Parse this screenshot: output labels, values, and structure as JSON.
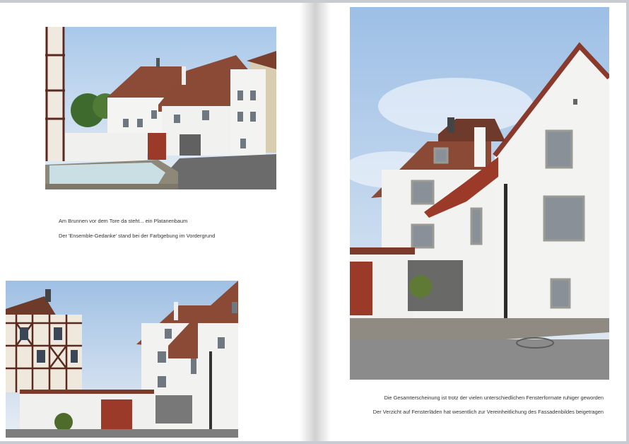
{
  "left_page": {
    "caption_line_1": "Am Brunnen vor dem Tore da steht... ein Platanenbaum",
    "caption_line_2": "Der 'Ensemble-Gedanke' stand bei der Farbgebung im Vordergrund"
  },
  "right_page": {
    "caption_line_1": "Die Gesamterscheinung ist trotz der vielen unterschiedlichen Fensterformate ruhiger geworden",
    "caption_line_2": "Der Verzicht auf Fensterläden hat wesentlich zur Vereinheitlichung des Fassadenbildes beigetragen"
  },
  "colors": {
    "page_background": "#ffffff",
    "spread_background": "#c8ccd2",
    "sky": "#a9c6e6",
    "wall": "#f3f3f1",
    "roof": "#8a4a36",
    "door": "#9b3a28",
    "timber": "#5a2a20"
  }
}
